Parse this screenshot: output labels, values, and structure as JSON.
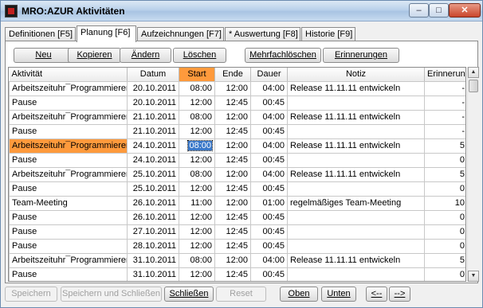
{
  "window": {
    "title": "MRO:AZUR Aktivitäten"
  },
  "tabs": [
    {
      "label": "Definitionen [F5]"
    },
    {
      "label": "Planung [F6]"
    },
    {
      "label": "Aufzeichnungen [F7]"
    },
    {
      "label": "* Auswertung [F8]"
    },
    {
      "label": "Historie [F9]"
    }
  ],
  "toolbar": {
    "neu": "Neu",
    "kopieren": "Kopieren",
    "aendern": "Ändern",
    "loeschen": "Löschen",
    "mehrfachloeschen": "Mehrfachlöschen",
    "erinnerungen": "Erinnerungen"
  },
  "grid": {
    "headers": [
      "Aktivität",
      "Datum",
      "Start",
      "Ende",
      "Dauer",
      "Notiz",
      "Erinnerung"
    ],
    "rows": [
      {
        "aktivitaet": "Arbeitszeituhr¯Programmieren",
        "datum": "20.10.2011",
        "start": "08:00",
        "ende": "12:00",
        "dauer": "04:00",
        "notiz": "Release 11.11.11 entwickeln",
        "erinnerung": "-"
      },
      {
        "aktivitaet": "Pause",
        "datum": "20.10.2011",
        "start": "12:00",
        "ende": "12:45",
        "dauer": "00:45",
        "notiz": "",
        "erinnerung": "-"
      },
      {
        "aktivitaet": "Arbeitszeituhr¯Programmieren",
        "datum": "21.10.2011",
        "start": "08:00",
        "ende": "12:00",
        "dauer": "04:00",
        "notiz": "Release 11.11.11 entwickeln",
        "erinnerung": "-"
      },
      {
        "aktivitaet": "Pause",
        "datum": "21.10.2011",
        "start": "12:00",
        "ende": "12:45",
        "dauer": "00:45",
        "notiz": "",
        "erinnerung": "-"
      },
      {
        "aktivitaet": "Arbeitszeituhr¯Programmieren",
        "datum": "24.10.2011",
        "start": "08:00",
        "ende": "12:00",
        "dauer": "04:00",
        "notiz": "Release 11.11.11 entwickeln",
        "erinnerung": "5"
      },
      {
        "aktivitaet": "Pause",
        "datum": "24.10.2011",
        "start": "12:00",
        "ende": "12:45",
        "dauer": "00:45",
        "notiz": "",
        "erinnerung": "0"
      },
      {
        "aktivitaet": "Arbeitszeituhr¯Programmieren",
        "datum": "25.10.2011",
        "start": "08:00",
        "ende": "12:00",
        "dauer": "04:00",
        "notiz": "Release 11.11.11 entwickeln",
        "erinnerung": "5"
      },
      {
        "aktivitaet": "Pause",
        "datum": "25.10.2011",
        "start": "12:00",
        "ende": "12:45",
        "dauer": "00:45",
        "notiz": "",
        "erinnerung": "0"
      },
      {
        "aktivitaet": "Team-Meeting",
        "datum": "26.10.2011",
        "start": "11:00",
        "ende": "12:00",
        "dauer": "01:00",
        "notiz": "regelmäßiges Team-Meeting",
        "erinnerung": "10"
      },
      {
        "aktivitaet": "Pause",
        "datum": "26.10.2011",
        "start": "12:00",
        "ende": "12:45",
        "dauer": "00:45",
        "notiz": "",
        "erinnerung": "0"
      },
      {
        "aktivitaet": "Pause",
        "datum": "27.10.2011",
        "start": "12:00",
        "ende": "12:45",
        "dauer": "00:45",
        "notiz": "",
        "erinnerung": "0"
      },
      {
        "aktivitaet": "Pause",
        "datum": "28.10.2011",
        "start": "12:00",
        "ende": "12:45",
        "dauer": "00:45",
        "notiz": "",
        "erinnerung": "0"
      },
      {
        "aktivitaet": "Arbeitszeituhr¯Programmieren",
        "datum": "31.10.2011",
        "start": "08:00",
        "ende": "12:00",
        "dauer": "04:00",
        "notiz": "Release 11.11.11 entwickeln",
        "erinnerung": "5"
      },
      {
        "aktivitaet": "Pause",
        "datum": "31.10.2011",
        "start": "12:00",
        "ende": "12:45",
        "dauer": "00:45",
        "notiz": "",
        "erinnerung": "0"
      }
    ]
  },
  "footer": {
    "speichern": "Speichern",
    "speichern_schliessen": "Speichern und Schließen",
    "schliessen": "Schließen",
    "reset": "Reset",
    "oben": "Oben",
    "unten": "Unten",
    "prev": "<--",
    "next": "-->"
  },
  "colors": {
    "accent": "#ff9a3c",
    "selection": "#3a78c9"
  }
}
